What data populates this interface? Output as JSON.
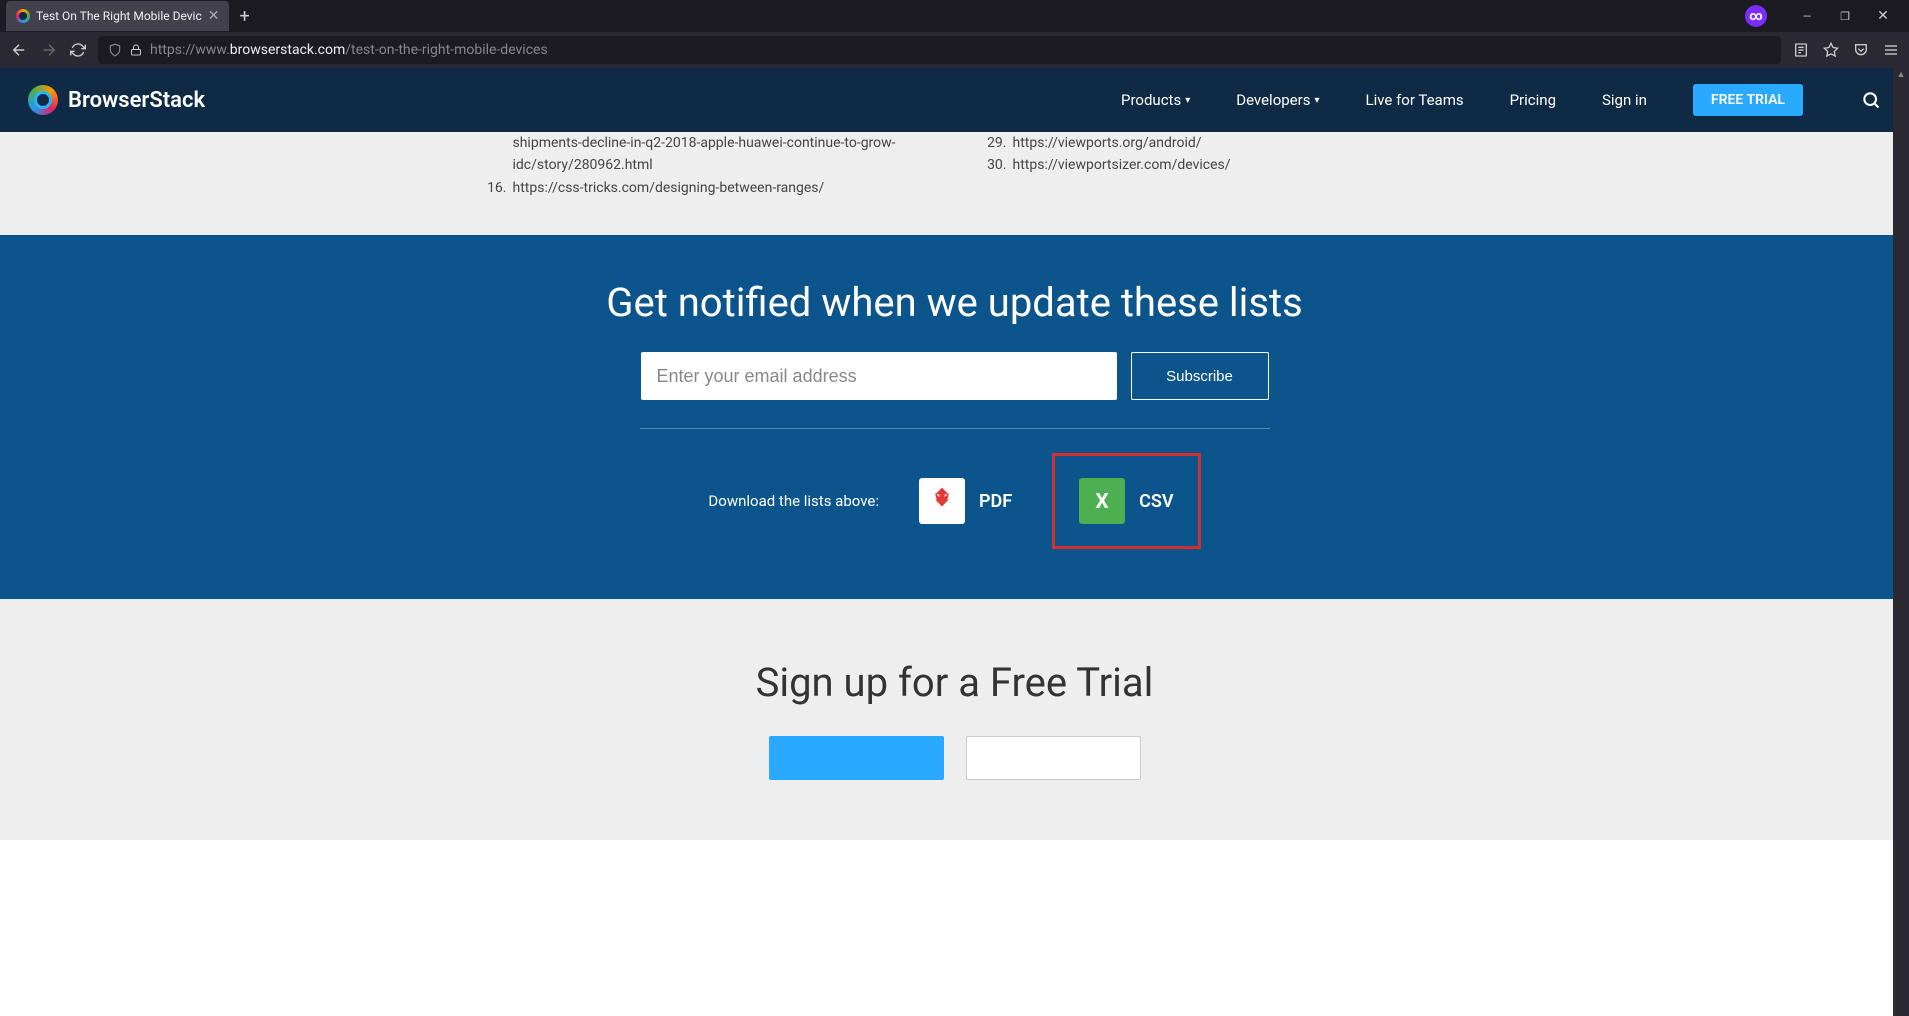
{
  "browser": {
    "tab_title": "Test On The Right Mobile Devic",
    "url_protocol": "https://www.",
    "url_domain": "browserstack.com",
    "url_path": "/test-on-the-right-mobile-devices"
  },
  "header": {
    "logo_text": "BrowserStack",
    "nav": {
      "products": "Products",
      "developers": "Developers",
      "live_teams": "Live for Teams",
      "pricing": "Pricing",
      "sign_in": "Sign in",
      "free_trial": "FREE TRIAL"
    }
  },
  "refs": {
    "left": [
      {
        "num": "",
        "text": "shipments-decline-in-q2-2018-apple-huawei-continue-to-grow-idc/story/280962.html"
      },
      {
        "num": "16.",
        "text": "https://css-tricks.com/designing-between-ranges/"
      }
    ],
    "right": [
      {
        "num": "29.",
        "text": "https://viewports.org/android/"
      },
      {
        "num": "30.",
        "text": "https://viewportsizer.com/devices/"
      }
    ]
  },
  "notify": {
    "heading": "Get notified when we update these lists",
    "email_placeholder": "Enter your email address",
    "subscribe_label": "Subscribe",
    "download_label": "Download the lists above:",
    "pdf_label": "PDF",
    "csv_label": "CSV"
  },
  "signup": {
    "heading": "Sign up for a Free Trial"
  }
}
